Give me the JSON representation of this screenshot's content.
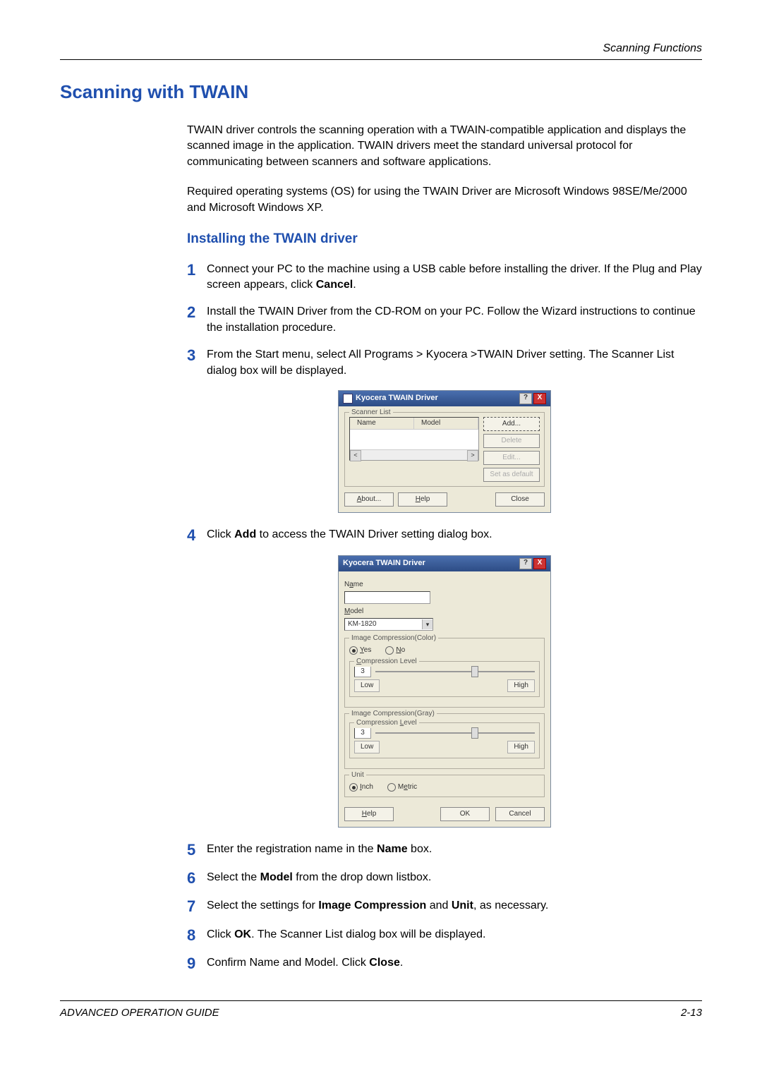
{
  "header": {
    "section": "Scanning Functions"
  },
  "h1": "Scanning with TWAIN",
  "intro1": "TWAIN driver controls the scanning operation with a TWAIN-compatible application and displays the scanned image in the application. TWAIN drivers meet the standard universal protocol for communicating between scanners and software applications.",
  "intro2": "Required operating systems (OS) for using the TWAIN Driver are Microsoft Windows 98SE/Me/2000 and Microsoft Windows XP.",
  "h2": "Installing the TWAIN driver",
  "steps": {
    "s1a": "Connect your PC to the machine using a USB cable before installing the driver. If the Plug and Play screen appears, click ",
    "s1b": "Cancel",
    "s1c": ".",
    "s2": "Install the TWAIN Driver from the CD-ROM on your PC. Follow the Wizard instructions to continue the installation procedure.",
    "s3": "From the Start menu, select All Programs > Kyocera >TWAIN Driver setting. The Scanner List dialog box will be displayed.",
    "s4a": "Click ",
    "s4b": "Add",
    "s4c": " to access the TWAIN Driver setting dialog box.",
    "s5a": "Enter the registration name in the ",
    "s5b": "Name",
    "s5c": " box.",
    "s6a": "Select the ",
    "s6b": "Model",
    "s6c": " from the drop down listbox.",
    "s7a": "Select the settings for ",
    "s7b": "Image Compression",
    "s7c": " and ",
    "s7d": "Unit",
    "s7e": ", as necessary.",
    "s8a": "Click ",
    "s8b": "OK",
    "s8c": ". The Scanner List dialog box will be displayed.",
    "s9a": "Confirm Name and Model. Click ",
    "s9b": "Close",
    "s9c": "."
  },
  "dialog1": {
    "title": "Kyocera TWAIN Driver",
    "group": "Scanner List",
    "col_name": "Name",
    "col_model": "Model",
    "btn_add": "Add...",
    "btn_delete": "Delete",
    "btn_edit": "Edit...",
    "btn_default": "Set as default",
    "btn_about": "About...",
    "btn_help": "Help",
    "btn_close": "Close",
    "help_q": "?",
    "close_x": "X"
  },
  "dialog2": {
    "title": "Kyocera TWAIN Driver",
    "lbl_name": "Name",
    "lbl_model": "Model",
    "model_value": "KM-1820",
    "grp_color": "Image Compression(Color)",
    "radio_yes": "Yes",
    "radio_no": "No",
    "grp_level": "Compression Level",
    "level_val_color": "3",
    "low": "Low",
    "high": "High",
    "grp_gray": "Image Compression(Gray)",
    "level_val_gray": "3",
    "grp_unit": "Unit",
    "radio_inch": "Inch",
    "radio_metric": "Metric",
    "btn_help": "Help",
    "btn_ok": "OK",
    "btn_cancel": "Cancel",
    "help_q": "?",
    "close_x": "X"
  },
  "footer": {
    "left": "ADVANCED OPERATION GUIDE",
    "right": "2-13"
  }
}
